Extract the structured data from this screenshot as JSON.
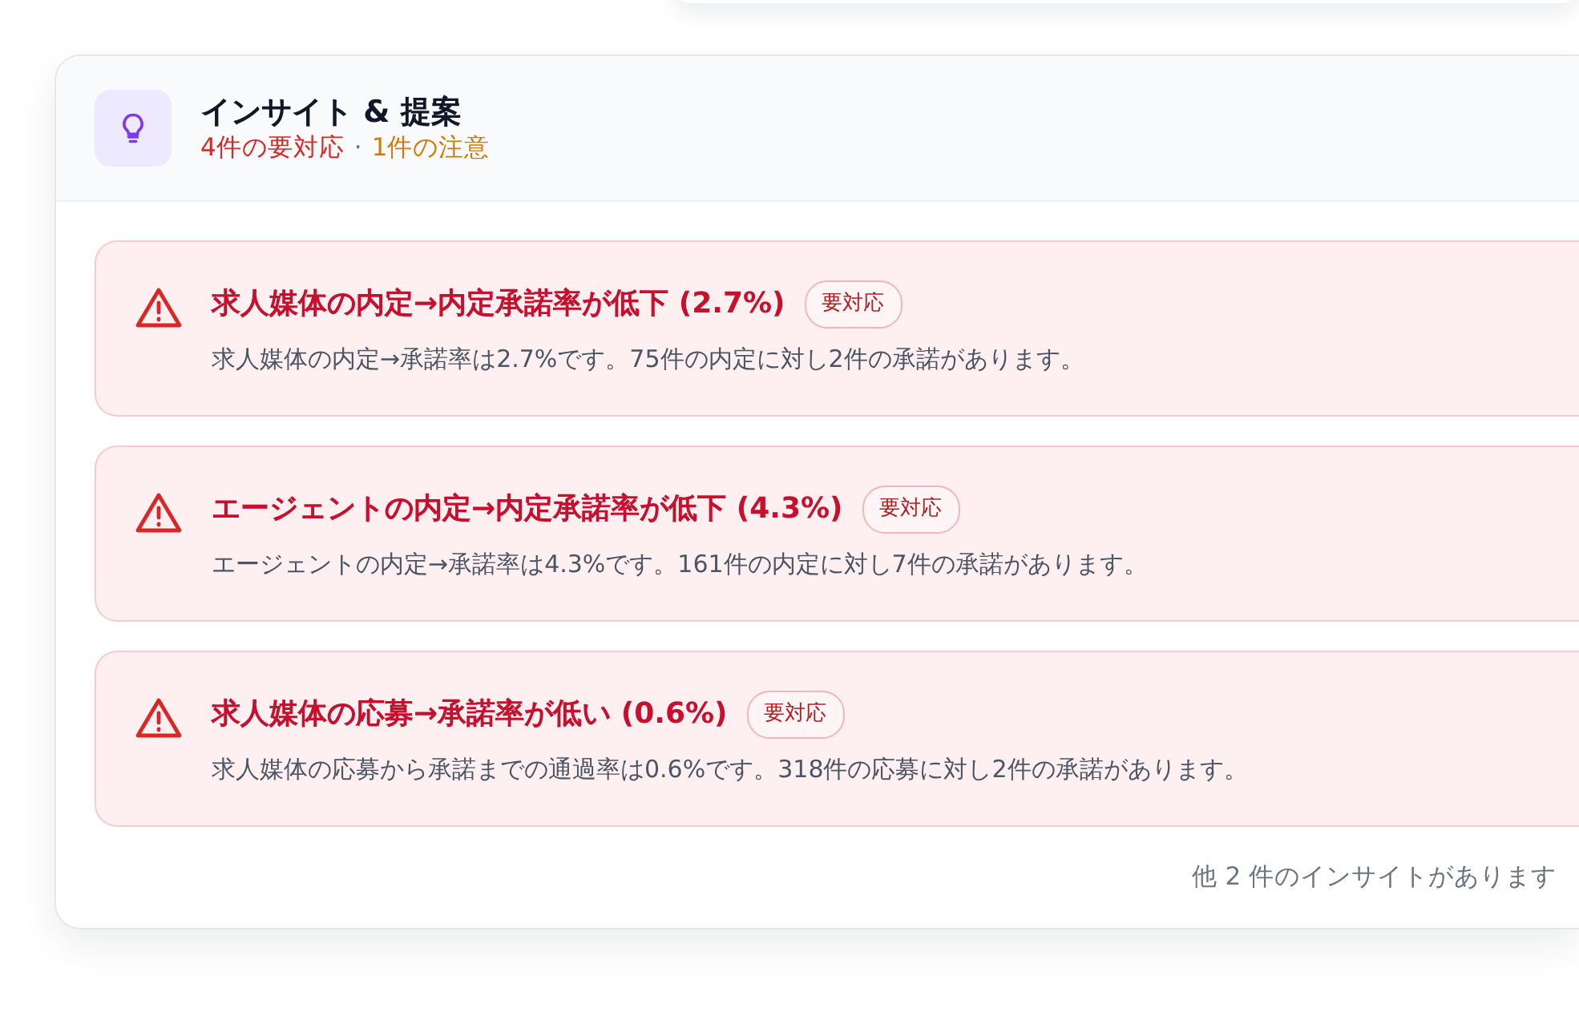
{
  "panel": {
    "title": "インサイト & 提案",
    "summary": [
      {
        "text": "4件の要対応",
        "kind": "critical"
      },
      {
        "text": "·",
        "kind": "separator"
      },
      {
        "text": "1件の注意",
        "kind": "warning"
      }
    ]
  },
  "insights": [
    {
      "kind": "critical",
      "title": "求人媒体の内定→内定承諾率が低下 (2.7%)",
      "badge": "要対応",
      "description": "求人媒体の内定→承諾率は2.7%です。75件の内定に対し2件の承諾があります。"
    },
    {
      "kind": "critical",
      "title": "エージェントの内定→内定承諾率が低下 (4.3%)",
      "badge": "要対応",
      "description": "エージェントの内定→承諾率は4.3%です。161件の内定に対し7件の承諾があります。"
    },
    {
      "kind": "critical",
      "title": "求人媒体の応募→承諾率が低い (0.6%)",
      "badge": "要対応",
      "description": "求人媒体の応募から承諾までの通過率は0.6%です。318件の応募に対し2件の承諾があります。"
    }
  ],
  "footer": "他 2 件のインサイトがあります"
}
